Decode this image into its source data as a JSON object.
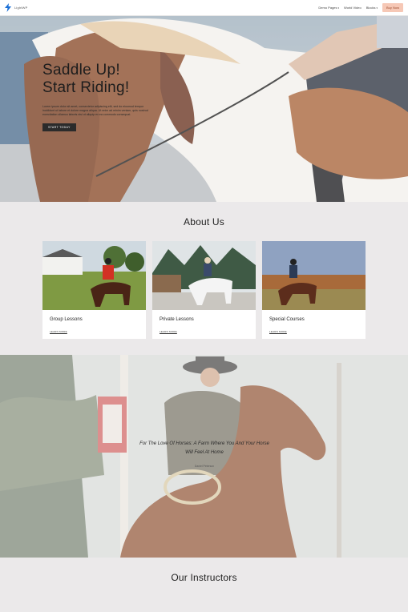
{
  "nav": {
    "logo_text": "LightWP",
    "menu": [
      {
        "label": "Demo Pages"
      },
      {
        "label": "World Video"
      },
      {
        "label": "Blocks"
      }
    ],
    "buy_label": "Buy Now",
    "colors": {
      "logo": "#1a6fd6",
      "buy_bg": "#f6c8b6"
    }
  },
  "hero": {
    "title_line1": "Saddle Up!",
    "title_line2": "Start Riding!",
    "text": "Lorem ipsum dolor sit amet, consectetur adipiscing elit, sed do eiusmod tempor incididunt ut labore et dolore magna aliqua. Ut enim ad minim veniam, quis nostrud exercitation ullamco laboris nisi ut aliquip ex ea commodo consequat.",
    "button_label": "START TODAY"
  },
  "about": {
    "title": "About Us",
    "cards": [
      {
        "title": "Group Lessons",
        "link": "LEARN MORE"
      },
      {
        "title": "Private Lessons",
        "link": "LEARN MORE"
      },
      {
        "title": "Special Courses",
        "link": "LEARN MORE"
      }
    ]
  },
  "quote": {
    "text": "For The Love Of Horses: A Farm Where You And Your Horse Will Feel At Home",
    "author": "Daniel Peterson"
  },
  "instructors": {
    "title": "Our Instructors"
  }
}
